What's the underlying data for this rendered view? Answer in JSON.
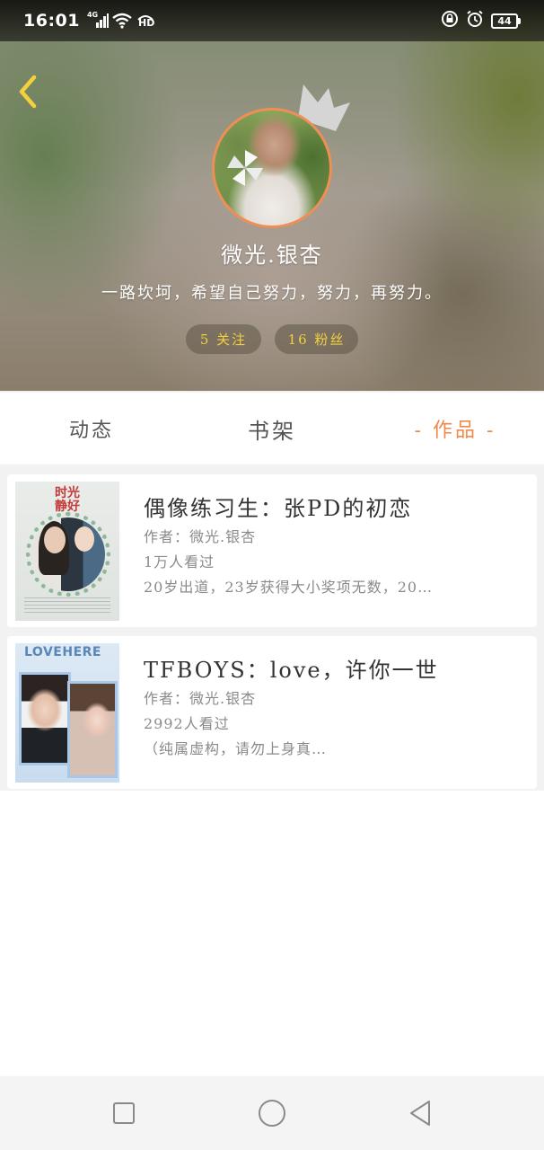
{
  "status_bar": {
    "time": "16:01",
    "network_label": "4G",
    "hd_label": "HD",
    "battery": "44"
  },
  "profile": {
    "username": "微光.银杏",
    "bio": "一路坎坷，希望自己努力，努力，再努力。",
    "following_label": "5 关注",
    "fans_label": "16 粉丝"
  },
  "tabs": [
    {
      "label": "动态",
      "active": false
    },
    {
      "label": "书架",
      "active": false
    },
    {
      "label": "- 作品 -",
      "active": true
    }
  ],
  "works": [
    {
      "title": "偶像练习生：张PD的初恋",
      "author": "作者：微光.银杏",
      "views": "1万人看过",
      "description": "20岁出道，23岁获得大小奖项无数，20…",
      "cover_text": "时光静好"
    },
    {
      "title": "TFBOYS：love，许你一世",
      "author": "作者：微光.银杏",
      "views": "2992人看过",
      "description": "（纯属虚构，请勿上身真…",
      "cover_text": "LOVEHERE"
    }
  ],
  "colors": {
    "accent": "#f0894c",
    "stat_text": "#f4d03f",
    "avatar_border": "#ee8f56"
  },
  "icons": {
    "back": "chevron-left-icon",
    "recents": "square-icon",
    "home": "circle-icon",
    "nav_back": "triangle-left-icon"
  }
}
